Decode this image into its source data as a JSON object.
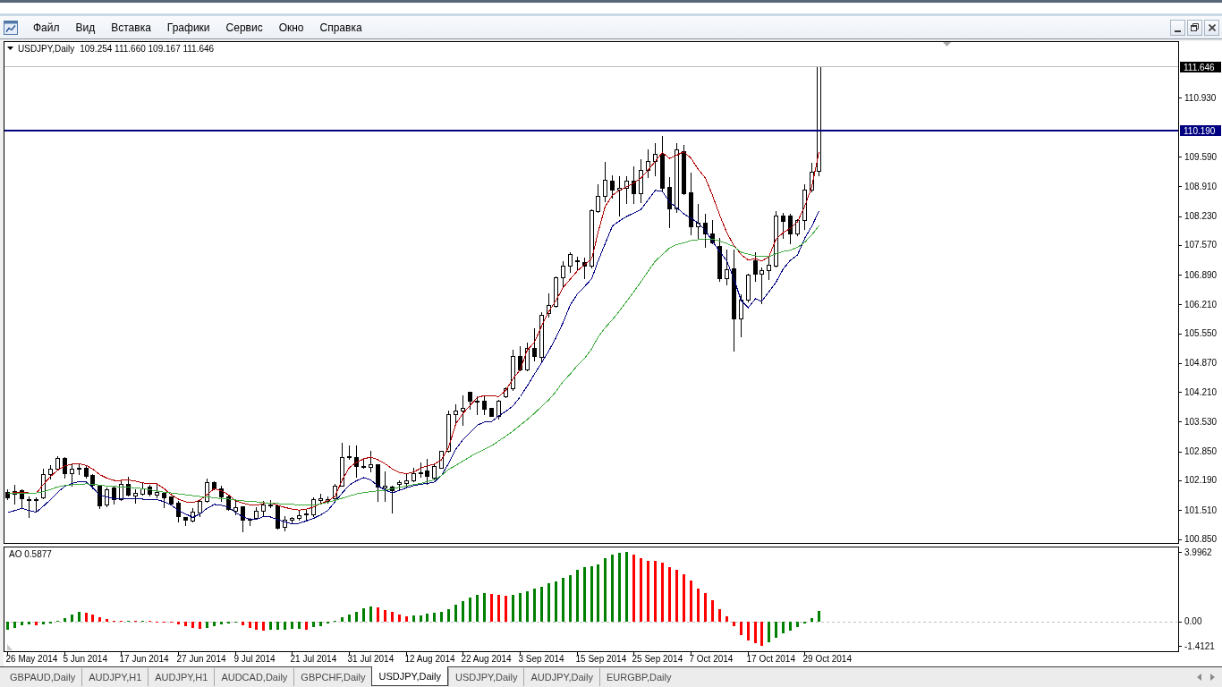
{
  "menu": [
    "Файл",
    "Вид",
    "Вставка",
    "Графики",
    "Сервис",
    "Окно",
    "Справка"
  ],
  "chart": {
    "chart_data": [
      {
        "type": "candlestick",
        "title": "USDJPY,Daily",
        "subtitle": "109.254 111.660 109.167 111.646",
        "tick_labels": "y",
        "ohlc": [
          [
            101.92,
            101.99,
            101.75,
            101.8
          ],
          [
            101.89,
            102.09,
            101.65,
            101.94
          ],
          [
            101.96,
            101.99,
            101.57,
            101.79
          ],
          [
            101.77,
            101.82,
            101.36,
            101.73
          ],
          [
            101.74,
            101.8,
            101.48,
            101.75
          ],
          [
            101.8,
            102.45,
            101.79,
            102.33
          ],
          [
            102.33,
            102.53,
            102.23,
            102.45
          ],
          [
            102.45,
            102.75,
            102.43,
            102.7
          ],
          [
            102.7,
            102.72,
            102.26,
            102.36
          ],
          [
            102.36,
            102.55,
            102.07,
            102.45
          ],
          [
            102.48,
            102.57,
            102.33,
            102.45
          ],
          [
            102.48,
            102.53,
            102.26,
            102.3
          ],
          [
            102.31,
            102.33,
            102.0,
            102.09
          ],
          [
            102.09,
            102.09,
            101.55,
            101.62
          ],
          [
            101.63,
            102.02,
            101.6,
            101.99
          ],
          [
            102.02,
            102.06,
            101.66,
            101.77
          ],
          [
            101.77,
            102.19,
            101.73,
            102.11
          ],
          [
            102.11,
            102.28,
            101.84,
            101.87
          ],
          [
            101.85,
            101.99,
            101.68,
            101.91
          ],
          [
            101.89,
            102.13,
            101.87,
            102.01
          ],
          [
            102.04,
            102.09,
            101.84,
            101.89
          ],
          [
            101.87,
            102.09,
            101.8,
            101.92
          ],
          [
            101.9,
            101.92,
            101.57,
            101.8
          ],
          [
            101.82,
            101.82,
            101.65,
            101.66
          ],
          [
            101.68,
            101.72,
            101.25,
            101.38
          ],
          [
            101.36,
            101.36,
            101.17,
            101.28
          ],
          [
            101.26,
            101.55,
            101.24,
            101.47
          ],
          [
            101.46,
            101.77,
            101.38,
            101.72
          ],
          [
            101.72,
            102.23,
            101.7,
            102.14
          ],
          [
            102.15,
            102.16,
            101.99,
            102.01
          ],
          [
            102.01,
            102.06,
            101.72,
            101.82
          ],
          [
            101.82,
            101.84,
            101.51,
            101.53
          ],
          [
            101.5,
            101.77,
            101.41,
            101.58
          ],
          [
            101.6,
            101.6,
            101.02,
            101.28
          ],
          [
            101.3,
            101.34,
            101.16,
            101.31
          ],
          [
            101.33,
            101.57,
            101.31,
            101.49
          ],
          [
            101.49,
            101.72,
            101.38,
            101.64
          ],
          [
            101.64,
            101.73,
            101.58,
            101.63
          ],
          [
            101.62,
            101.62,
            101.08,
            101.11
          ],
          [
            101.12,
            101.38,
            101.04,
            101.28
          ],
          [
            101.28,
            101.36,
            101.23,
            101.34
          ],
          [
            101.33,
            101.5,
            101.28,
            101.4
          ],
          [
            101.42,
            101.51,
            101.28,
            101.43
          ],
          [
            101.42,
            101.8,
            101.38,
            101.75
          ],
          [
            101.74,
            101.89,
            101.68,
            101.79
          ],
          [
            101.72,
            101.82,
            101.68,
            101.77
          ],
          [
            101.79,
            102.11,
            101.77,
            102.07
          ],
          [
            102.06,
            103.04,
            102.06,
            102.72
          ],
          [
            102.74,
            102.98,
            102.69,
            102.75
          ],
          [
            102.72,
            102.98,
            102.28,
            102.52
          ],
          [
            102.51,
            102.67,
            102.47,
            102.5
          ],
          [
            102.5,
            102.87,
            102.4,
            102.55
          ],
          [
            102.56,
            102.56,
            101.72,
            102.04
          ],
          [
            102.03,
            102.4,
            101.72,
            102.06
          ],
          [
            102.04,
            102.06,
            101.45,
            101.96
          ],
          [
            102.1,
            102.18,
            101.99,
            102.14
          ],
          [
            102.13,
            102.33,
            102.02,
            102.19
          ],
          [
            102.19,
            102.48,
            102.16,
            102.36
          ],
          [
            102.37,
            102.6,
            102.27,
            102.38
          ],
          [
            102.41,
            102.67,
            102.11,
            102.29
          ],
          [
            102.26,
            102.55,
            102.23,
            102.51
          ],
          [
            102.48,
            102.87,
            102.47,
            102.86
          ],
          [
            102.86,
            103.79,
            102.84,
            103.7
          ],
          [
            103.7,
            103.93,
            103.52,
            103.79
          ],
          [
            103.78,
            104.13,
            103.45,
            103.85
          ],
          [
            104.22,
            104.22,
            103.83,
            104.0
          ],
          [
            104.0,
            104.11,
            103.7,
            104.01
          ],
          [
            104.01,
            104.11,
            103.7,
            103.83
          ],
          [
            103.84,
            103.85,
            103.66,
            103.67
          ],
          [
            103.67,
            104.03,
            103.61,
            104.0
          ],
          [
            104.11,
            104.31,
            104.1,
            104.3
          ],
          [
            104.29,
            105.17,
            104.25,
            105.03
          ],
          [
            105.03,
            105.25,
            104.71,
            104.72
          ],
          [
            104.72,
            105.34,
            104.7,
            105.22
          ],
          [
            105.22,
            105.66,
            104.93,
            105.03
          ],
          [
            105.02,
            106.04,
            104.93,
            105.97
          ],
          [
            106.01,
            106.46,
            105.93,
            106.2
          ],
          [
            106.18,
            106.85,
            106.15,
            106.83
          ],
          [
            106.83,
            107.2,
            106.61,
            107.1
          ],
          [
            107.1,
            107.4,
            106.95,
            107.36
          ],
          [
            107.21,
            107.3,
            106.99,
            107.2
          ],
          [
            107.18,
            107.28,
            106.81,
            107.1
          ],
          [
            107.1,
            108.38,
            107.05,
            108.36
          ],
          [
            108.34,
            108.95,
            108.32,
            108.69
          ],
          [
            108.69,
            109.46,
            108.56,
            109.05
          ],
          [
            109.03,
            109.16,
            108.65,
            108.83
          ],
          [
            108.83,
            109.14,
            108.24,
            108.87
          ],
          [
            108.87,
            109.14,
            108.52,
            109.03
          ],
          [
            109.03,
            109.36,
            108.52,
            108.75
          ],
          [
            108.75,
            109.52,
            108.54,
            109.28
          ],
          [
            109.28,
            109.75,
            109.12,
            109.48
          ],
          [
            109.48,
            109.89,
            109.16,
            109.65
          ],
          [
            109.65,
            110.07,
            108.8,
            108.87
          ],
          [
            108.89,
            109.12,
            107.97,
            108.4
          ],
          [
            108.4,
            109.89,
            108.32,
            109.75
          ],
          [
            109.71,
            109.85,
            108.73,
            108.75
          ],
          [
            108.77,
            109.22,
            107.81,
            107.99
          ],
          [
            107.99,
            108.5,
            107.73,
            108.07
          ],
          [
            108.07,
            108.28,
            107.52,
            107.83
          ],
          [
            107.83,
            108.14,
            107.61,
            107.63
          ],
          [
            107.54,
            107.73,
            106.75,
            106.81
          ],
          [
            106.81,
            107.46,
            106.67,
            107.01
          ],
          [
            107.03,
            107.46,
            105.16,
            105.89
          ],
          [
            105.89,
            106.44,
            105.48,
            106.32
          ],
          [
            106.32,
            106.91,
            106.28,
            106.89
          ],
          [
            107.22,
            107.4,
            106.75,
            106.91
          ],
          [
            106.91,
            107.05,
            106.24,
            106.99
          ],
          [
            106.99,
            107.3,
            106.79,
            107.12
          ],
          [
            107.1,
            108.34,
            107.08,
            108.24
          ],
          [
            108.24,
            108.3,
            107.73,
            108.12
          ],
          [
            108.24,
            108.28,
            107.61,
            107.83
          ],
          [
            107.83,
            108.16,
            107.8,
            108.14
          ],
          [
            108.14,
            108.95,
            107.93,
            108.83
          ],
          [
            108.83,
            109.44,
            108.79,
            109.24
          ],
          [
            109.254,
            111.66,
            109.167,
            111.646
          ]
        ],
        "series": [
          {
            "type": "line",
            "color": "#b00000",
            "values": [
              101.89,
              101.91,
              101.92,
              101.9,
              101.89,
              102.1,
              102.28,
              102.42,
              102.52,
              102.56,
              102.57,
              102.53,
              102.45,
              102.32,
              102.24,
              102.19,
              102.19,
              102.2,
              102.17,
              102.13,
              102.12,
              102.11,
              102.0,
              101.86,
              101.76,
              101.7,
              101.68,
              101.74,
              101.86,
              102.0,
              101.95,
              101.86,
              101.72,
              101.67,
              101.63,
              101.62,
              101.66,
              101.68,
              101.62,
              101.57,
              101.53,
              101.51,
              101.53,
              101.58,
              101.66,
              101.72,
              101.82,
              102.2,
              102.48,
              102.6,
              102.68,
              102.72,
              102.66,
              102.57,
              102.45,
              102.37,
              102.34,
              102.38,
              102.47,
              102.52,
              102.56,
              102.66,
              102.95,
              103.48,
              103.72,
              103.9,
              104.08,
              104.13,
              104.13,
              104.1,
              104.25,
              104.51,
              104.72,
              105.17,
              105.35,
              105.72,
              106.05,
              106.3,
              106.6,
              106.79,
              106.98,
              107.12,
              107.25,
              107.85,
              108.45,
              108.7,
              108.82,
              108.9,
              108.98,
              109.1,
              109.28,
              109.48,
              109.68,
              109.55,
              109.62,
              109.7,
              109.55,
              109.3,
              109.1,
              108.7,
              108.25,
              107.85,
              107.55,
              107.35,
              107.22,
              107.26,
              107.2,
              107.3,
              107.7,
              107.85,
              107.95,
              108.1,
              108.45,
              108.9,
              109.7
            ]
          },
          {
            "type": "line",
            "color": "#000080",
            "values": [
              101.45,
              101.5,
              101.55,
              101.5,
              101.46,
              101.6,
              101.75,
              101.92,
              102.05,
              102.12,
              102.16,
              102.15,
              102.03,
              101.85,
              101.81,
              101.77,
              101.77,
              101.77,
              101.77,
              101.76,
              101.76,
              101.75,
              101.7,
              101.62,
              101.5,
              101.42,
              101.34,
              101.42,
              101.55,
              101.64,
              101.62,
              101.58,
              101.45,
              101.36,
              101.3,
              101.3,
              101.36,
              101.35,
              101.29,
              101.24,
              101.19,
              101.21,
              101.26,
              101.32,
              101.4,
              101.5,
              101.7,
              101.9,
              102.08,
              102.18,
              102.25,
              102.2,
              102.06,
              101.97,
              101.9,
              101.96,
              102.02,
              102.07,
              102.1,
              102.12,
              102.15,
              102.3,
              102.58,
              102.9,
              103.12,
              103.28,
              103.45,
              103.52,
              103.53,
              103.66,
              103.77,
              103.89,
              104.1,
              104.35,
              104.62,
              104.88,
              105.15,
              105.45,
              105.8,
              106.2,
              106.45,
              106.62,
              106.8,
              107.2,
              107.6,
              108.0,
              108.12,
              108.22,
              108.3,
              108.38,
              108.6,
              108.82,
              108.79,
              108.55,
              108.42,
              108.28,
              108.18,
              108.07,
              107.9,
              107.65,
              107.42,
              107.2,
              106.79,
              106.3,
              106.14,
              106.34,
              106.28,
              106.5,
              106.72,
              107.02,
              107.22,
              107.34,
              107.72,
              108.0,
              108.34
            ]
          },
          {
            "type": "line",
            "color": "#3caa3c",
            "values": [
              101.89,
              101.89,
              101.89,
              101.89,
              101.9,
              101.93,
              101.98,
              102.04,
              102.07,
              102.09,
              102.1,
              102.11,
              102.1,
              102.08,
              102.06,
              102.05,
              102.04,
              102.03,
              102.02,
              102.0,
              101.97,
              101.95,
              101.92,
              101.9,
              101.88,
              101.86,
              101.84,
              101.82,
              101.81,
              101.79,
              101.77,
              101.76,
              101.74,
              101.72,
              101.71,
              101.7,
              101.68,
              101.67,
              101.66,
              101.65,
              101.64,
              101.63,
              101.62,
              101.62,
              101.65,
              101.69,
              101.73,
              101.78,
              101.83,
              101.88,
              101.91,
              101.93,
              101.95,
              101.96,
              102.0,
              102.03,
              102.06,
              102.09,
              102.12,
              102.16,
              102.2,
              102.3,
              102.44,
              102.53,
              102.63,
              102.73,
              102.82,
              102.9,
              102.98,
              103.09,
              103.2,
              103.32,
              103.45,
              103.58,
              103.72,
              103.88,
              104.03,
              104.22,
              104.45,
              104.62,
              104.82,
              104.98,
              105.2,
              105.46,
              105.68,
              105.86,
              106.06,
              106.28,
              106.5,
              106.73,
              106.97,
              107.2,
              107.35,
              107.5,
              107.58,
              107.62,
              107.67,
              107.69,
              107.71,
              107.7,
              107.66,
              107.6,
              107.53,
              107.4,
              107.36,
              107.32,
              107.31,
              107.3,
              107.37,
              107.42,
              107.45,
              107.52,
              107.63,
              107.8,
              108.01
            ]
          }
        ],
        "ylim": [
          100.758,
          112.207
        ],
        "yticks": [
          {
            "value": 110.93,
            "label": "110.930"
          },
          {
            "value": 109.59,
            "label": "109.590"
          },
          {
            "value": 108.91,
            "label": "108.910"
          },
          {
            "value": 108.23,
            "label": "108.230"
          },
          {
            "value": 107.57,
            "label": "107.570"
          },
          {
            "value": 106.89,
            "label": "106.890"
          },
          {
            "value": 106.21,
            "label": "106.210"
          },
          {
            "value": 105.55,
            "label": "105.550"
          },
          {
            "value": 104.87,
            "label": "104.870"
          },
          {
            "value": 104.21,
            "label": "104.210"
          },
          {
            "value": 103.53,
            "label": "103.530"
          },
          {
            "value": 102.85,
            "label": "102.850"
          },
          {
            "value": 102.19,
            "label": "102.190"
          },
          {
            "value": 101.51,
            "label": "101.510"
          },
          {
            "value": 100.85,
            "label": "100.850"
          }
        ],
        "ref_lines": [
          {
            "axis": "y",
            "value": 111.646,
            "label": "111.646",
            "color": "#c0c0c0"
          },
          {
            "axis": "y",
            "value": 110.19,
            "label": "110.190",
            "color": "#000080"
          }
        ]
      },
      {
        "type": "bar",
        "title": "AO 0.5877",
        "values": [
          -0.48,
          -0.4,
          -0.22,
          -0.18,
          -0.22,
          -0.18,
          -0.13,
          0.04,
          0.18,
          0.4,
          0.52,
          0.48,
          0.4,
          0.22,
          0.13,
          0.04,
          0.02,
          0.03,
          0.02,
          0.04,
          0.03,
          -0.02,
          -0.04,
          -0.09,
          -0.18,
          -0.26,
          -0.4,
          -0.42,
          -0.37,
          -0.26,
          -0.18,
          -0.13,
          -0.09,
          -0.22,
          -0.37,
          -0.48,
          -0.53,
          -0.51,
          -0.48,
          -0.46,
          -0.44,
          -0.43,
          -0.48,
          -0.35,
          -0.26,
          -0.13,
          0.02,
          0.22,
          0.4,
          0.57,
          0.73,
          0.86,
          0.79,
          0.66,
          0.53,
          0.4,
          0.31,
          0.32,
          0.35,
          0.44,
          0.51,
          0.55,
          0.7,
          0.95,
          1.17,
          1.39,
          1.54,
          1.65,
          1.56,
          1.5,
          1.45,
          1.54,
          1.62,
          1.73,
          1.86,
          1.99,
          2.17,
          2.32,
          2.48,
          2.67,
          2.95,
          3.12,
          3.19,
          3.28,
          3.61,
          3.83,
          3.96,
          3.99,
          3.83,
          3.61,
          3.5,
          3.48,
          3.39,
          3.12,
          2.95,
          2.72,
          2.34,
          1.9,
          1.62,
          1.24,
          0.68,
          0.29,
          -0.26,
          -0.77,
          -1.1,
          -1.27,
          -1.41,
          -1.2,
          -0.94,
          -0.7,
          -0.53,
          -0.35,
          -0.11,
          0.18,
          0.59,
          null,
          null,
          null,
          null,
          null,
          null,
          null,
          null,
          null,
          null,
          null,
          null,
          null,
          null,
          null,
          null,
          null,
          null,
          null,
          null,
          null,
          null,
          null,
          null,
          null,
          null,
          null,
          null,
          null,
          null,
          null,
          null,
          null,
          null,
          null,
          null,
          null,
          null,
          null,
          null,
          null,
          null,
          null,
          null,
          null,
          null,
          null,
          null,
          null,
          null
        ],
        "colors": [
          "#008000",
          "#008000",
          "#008000",
          "#008000",
          "#ff0000",
          "#008000",
          "#008000",
          "#008000",
          "#008000",
          "#008000",
          "#008000",
          "#ff0000",
          "#ff0000",
          "#ff0000",
          "#ff0000",
          "#ff0000",
          "#ff0000",
          "#008000",
          "#ff0000",
          "#008000",
          "#ff0000",
          "#ff0000",
          "#ff0000",
          "#ff0000",
          "#ff0000",
          "#ff0000",
          "#ff0000",
          "#ff0000",
          "#008000",
          "#008000",
          "#008000",
          "#008000",
          "#008000",
          "#ff0000",
          "#ff0000",
          "#ff0000",
          "#ff0000",
          "#008000",
          "#008000",
          "#008000",
          "#008000",
          "#008000",
          "#ff0000",
          "#008000",
          "#008000",
          "#008000",
          "#008000",
          "#008000",
          "#008000",
          "#008000",
          "#008000",
          "#008000",
          "#ff0000",
          "#ff0000",
          "#ff0000",
          "#ff0000",
          "#ff0000",
          "#008000",
          "#008000",
          "#008000",
          "#008000",
          "#008000",
          "#008000",
          "#008000",
          "#008000",
          "#008000",
          "#008000",
          "#008000",
          "#ff0000",
          "#ff0000",
          "#ff0000",
          "#008000",
          "#008000",
          "#008000",
          "#008000",
          "#008000",
          "#008000",
          "#008000",
          "#008000",
          "#008000",
          "#008000",
          "#008000",
          "#008000",
          "#008000",
          "#008000",
          "#008000",
          "#008000",
          "#008000",
          "#ff0000",
          "#ff0000",
          "#ff0000",
          "#ff0000",
          "#ff0000",
          "#ff0000",
          "#ff0000",
          "#ff0000",
          "#ff0000",
          "#ff0000",
          "#ff0000",
          "#ff0000",
          "#ff0000",
          "#ff0000",
          "#ff0000",
          "#ff0000",
          "#ff0000",
          "#ff0000",
          "#ff0000",
          "#008000",
          "#008000",
          "#008000",
          "#008000",
          "#008000",
          "#008000",
          "#008000",
          "#008000",
          null,
          null,
          null,
          null,
          null,
          null,
          null,
          null,
          null,
          null,
          null,
          null,
          null,
          null,
          null,
          null,
          null,
          null,
          null,
          null,
          null,
          null,
          null,
          null,
          null,
          null,
          null,
          null,
          null,
          null,
          null,
          null,
          null,
          null,
          null,
          null,
          null,
          null,
          null,
          null,
          null,
          null,
          null,
          null,
          null,
          null,
          null,
          null,
          null,
          null
        ],
        "ylim": [
          -1.4121,
          3.9962
        ],
        "yticks": [
          3.9962,
          {
            "value": 0,
            "label": "0.00"
          },
          -1.4121
        ],
        "ref_lines": [
          {
            "axis": "y",
            "value": 0,
            "color": "#c0c0c0",
            "line_style": "dashed"
          }
        ]
      }
    ],
    "time_axis": [
      "26 May 2014",
      "5 Jun 2014",
      "17 Jun 2014",
      "27 Jun 2014",
      "9 Jul 2014",
      "21 Jul 2014",
      "31 Jul 2014",
      "12 Aug 2014",
      "22 Aug 2014",
      "3 Sep 2014",
      "15 Sep 2014",
      "25 Sep 2014",
      "7 Oct 2014",
      "17 Oct 2014",
      "29 Oct 2014"
    ]
  },
  "tabs": [
    {
      "label": "GBPAUD,Daily",
      "selected": false
    },
    {
      "label": "AUDJPY,H1",
      "selected": false
    },
    {
      "label": "AUDJPY,H1",
      "selected": false
    },
    {
      "label": "AUDCAD,Daily",
      "selected": false
    },
    {
      "label": "GBPCHF,Daily",
      "selected": false
    },
    {
      "label": "USDJPY,Daily",
      "selected": true
    },
    {
      "label": "USDJPY,Daily",
      "selected": false
    },
    {
      "label": "AUDJPY,Daily",
      "selected": false
    },
    {
      "label": "EURGBP,Daily",
      "selected": false
    }
  ]
}
